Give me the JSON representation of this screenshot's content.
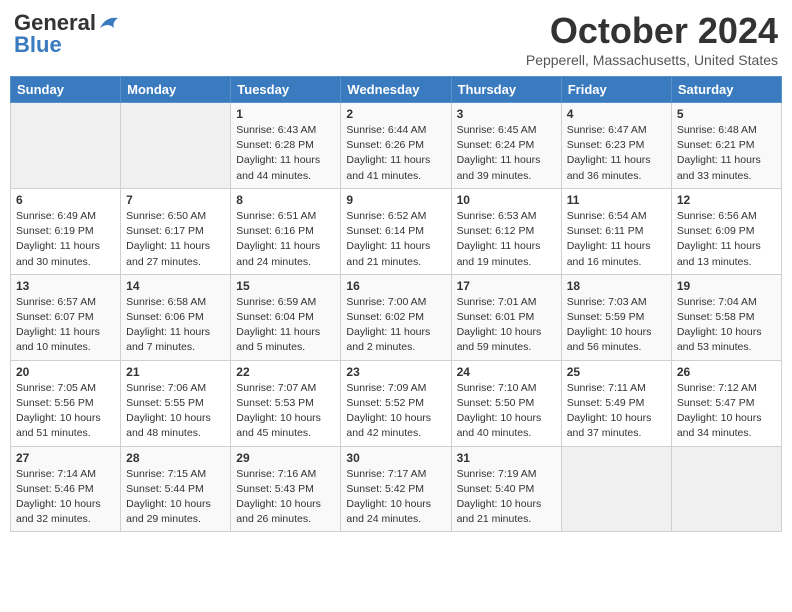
{
  "header": {
    "logo_general": "General",
    "logo_blue": "Blue",
    "month": "October 2024",
    "location": "Pepperell, Massachusetts, United States"
  },
  "days_of_week": [
    "Sunday",
    "Monday",
    "Tuesday",
    "Wednesday",
    "Thursday",
    "Friday",
    "Saturday"
  ],
  "weeks": [
    [
      {
        "day": null
      },
      {
        "day": null
      },
      {
        "day": "1",
        "sunrise": "Sunrise: 6:43 AM",
        "sunset": "Sunset: 6:28 PM",
        "daylight": "Daylight: 11 hours and 44 minutes."
      },
      {
        "day": "2",
        "sunrise": "Sunrise: 6:44 AM",
        "sunset": "Sunset: 6:26 PM",
        "daylight": "Daylight: 11 hours and 41 minutes."
      },
      {
        "day": "3",
        "sunrise": "Sunrise: 6:45 AM",
        "sunset": "Sunset: 6:24 PM",
        "daylight": "Daylight: 11 hours and 39 minutes."
      },
      {
        "day": "4",
        "sunrise": "Sunrise: 6:47 AM",
        "sunset": "Sunset: 6:23 PM",
        "daylight": "Daylight: 11 hours and 36 minutes."
      },
      {
        "day": "5",
        "sunrise": "Sunrise: 6:48 AM",
        "sunset": "Sunset: 6:21 PM",
        "daylight": "Daylight: 11 hours and 33 minutes."
      }
    ],
    [
      {
        "day": "6",
        "sunrise": "Sunrise: 6:49 AM",
        "sunset": "Sunset: 6:19 PM",
        "daylight": "Daylight: 11 hours and 30 minutes."
      },
      {
        "day": "7",
        "sunrise": "Sunrise: 6:50 AM",
        "sunset": "Sunset: 6:17 PM",
        "daylight": "Daylight: 11 hours and 27 minutes."
      },
      {
        "day": "8",
        "sunrise": "Sunrise: 6:51 AM",
        "sunset": "Sunset: 6:16 PM",
        "daylight": "Daylight: 11 hours and 24 minutes."
      },
      {
        "day": "9",
        "sunrise": "Sunrise: 6:52 AM",
        "sunset": "Sunset: 6:14 PM",
        "daylight": "Daylight: 11 hours and 21 minutes."
      },
      {
        "day": "10",
        "sunrise": "Sunrise: 6:53 AM",
        "sunset": "Sunset: 6:12 PM",
        "daylight": "Daylight: 11 hours and 19 minutes."
      },
      {
        "day": "11",
        "sunrise": "Sunrise: 6:54 AM",
        "sunset": "Sunset: 6:11 PM",
        "daylight": "Daylight: 11 hours and 16 minutes."
      },
      {
        "day": "12",
        "sunrise": "Sunrise: 6:56 AM",
        "sunset": "Sunset: 6:09 PM",
        "daylight": "Daylight: 11 hours and 13 minutes."
      }
    ],
    [
      {
        "day": "13",
        "sunrise": "Sunrise: 6:57 AM",
        "sunset": "Sunset: 6:07 PM",
        "daylight": "Daylight: 11 hours and 10 minutes."
      },
      {
        "day": "14",
        "sunrise": "Sunrise: 6:58 AM",
        "sunset": "Sunset: 6:06 PM",
        "daylight": "Daylight: 11 hours and 7 minutes."
      },
      {
        "day": "15",
        "sunrise": "Sunrise: 6:59 AM",
        "sunset": "Sunset: 6:04 PM",
        "daylight": "Daylight: 11 hours and 5 minutes."
      },
      {
        "day": "16",
        "sunrise": "Sunrise: 7:00 AM",
        "sunset": "Sunset: 6:02 PM",
        "daylight": "Daylight: 11 hours and 2 minutes."
      },
      {
        "day": "17",
        "sunrise": "Sunrise: 7:01 AM",
        "sunset": "Sunset: 6:01 PM",
        "daylight": "Daylight: 10 hours and 59 minutes."
      },
      {
        "day": "18",
        "sunrise": "Sunrise: 7:03 AM",
        "sunset": "Sunset: 5:59 PM",
        "daylight": "Daylight: 10 hours and 56 minutes."
      },
      {
        "day": "19",
        "sunrise": "Sunrise: 7:04 AM",
        "sunset": "Sunset: 5:58 PM",
        "daylight": "Daylight: 10 hours and 53 minutes."
      }
    ],
    [
      {
        "day": "20",
        "sunrise": "Sunrise: 7:05 AM",
        "sunset": "Sunset: 5:56 PM",
        "daylight": "Daylight: 10 hours and 51 minutes."
      },
      {
        "day": "21",
        "sunrise": "Sunrise: 7:06 AM",
        "sunset": "Sunset: 5:55 PM",
        "daylight": "Daylight: 10 hours and 48 minutes."
      },
      {
        "day": "22",
        "sunrise": "Sunrise: 7:07 AM",
        "sunset": "Sunset: 5:53 PM",
        "daylight": "Daylight: 10 hours and 45 minutes."
      },
      {
        "day": "23",
        "sunrise": "Sunrise: 7:09 AM",
        "sunset": "Sunset: 5:52 PM",
        "daylight": "Daylight: 10 hours and 42 minutes."
      },
      {
        "day": "24",
        "sunrise": "Sunrise: 7:10 AM",
        "sunset": "Sunset: 5:50 PM",
        "daylight": "Daylight: 10 hours and 40 minutes."
      },
      {
        "day": "25",
        "sunrise": "Sunrise: 7:11 AM",
        "sunset": "Sunset: 5:49 PM",
        "daylight": "Daylight: 10 hours and 37 minutes."
      },
      {
        "day": "26",
        "sunrise": "Sunrise: 7:12 AM",
        "sunset": "Sunset: 5:47 PM",
        "daylight": "Daylight: 10 hours and 34 minutes."
      }
    ],
    [
      {
        "day": "27",
        "sunrise": "Sunrise: 7:14 AM",
        "sunset": "Sunset: 5:46 PM",
        "daylight": "Daylight: 10 hours and 32 minutes."
      },
      {
        "day": "28",
        "sunrise": "Sunrise: 7:15 AM",
        "sunset": "Sunset: 5:44 PM",
        "daylight": "Daylight: 10 hours and 29 minutes."
      },
      {
        "day": "29",
        "sunrise": "Sunrise: 7:16 AM",
        "sunset": "Sunset: 5:43 PM",
        "daylight": "Daylight: 10 hours and 26 minutes."
      },
      {
        "day": "30",
        "sunrise": "Sunrise: 7:17 AM",
        "sunset": "Sunset: 5:42 PM",
        "daylight": "Daylight: 10 hours and 24 minutes."
      },
      {
        "day": "31",
        "sunrise": "Sunrise: 7:19 AM",
        "sunset": "Sunset: 5:40 PM",
        "daylight": "Daylight: 10 hours and 21 minutes."
      },
      {
        "day": null
      },
      {
        "day": null
      }
    ]
  ]
}
